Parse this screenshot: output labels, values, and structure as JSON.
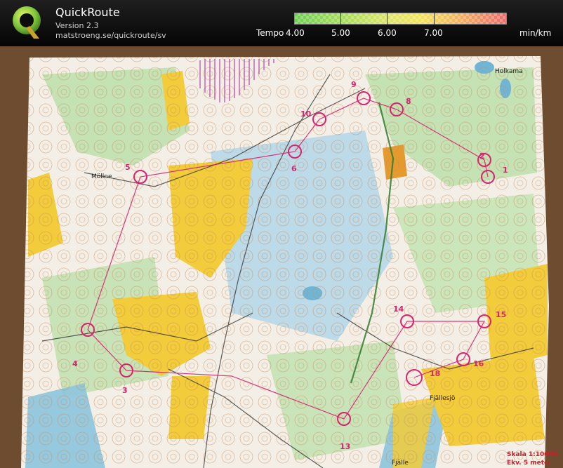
{
  "app": {
    "title": "QuickRoute",
    "version": "Version 2.3",
    "url": "matstroeng.se/quickroute/sv"
  },
  "legend": {
    "label": "Tempo",
    "ticks": [
      "4.00",
      "5.00",
      "6.00",
      "7.00"
    ],
    "unit": "min/km",
    "colors": [
      "#6fcf54",
      "#a4dc58",
      "#dfe568",
      "#f3e25a",
      "#f2b161",
      "#ea6b6b"
    ]
  },
  "map": {
    "controls": [
      "1",
      "2",
      "3",
      "4",
      "5",
      "6",
      "8",
      "9",
      "10",
      "13",
      "14",
      "15",
      "16",
      "18"
    ],
    "place_names": [
      "Holkama",
      "Fjällesjö",
      "Fjälle",
      "Möllne"
    ],
    "scale_text": "Skala 1:10000",
    "equidistance_text": "Ekv. 5 meter"
  }
}
